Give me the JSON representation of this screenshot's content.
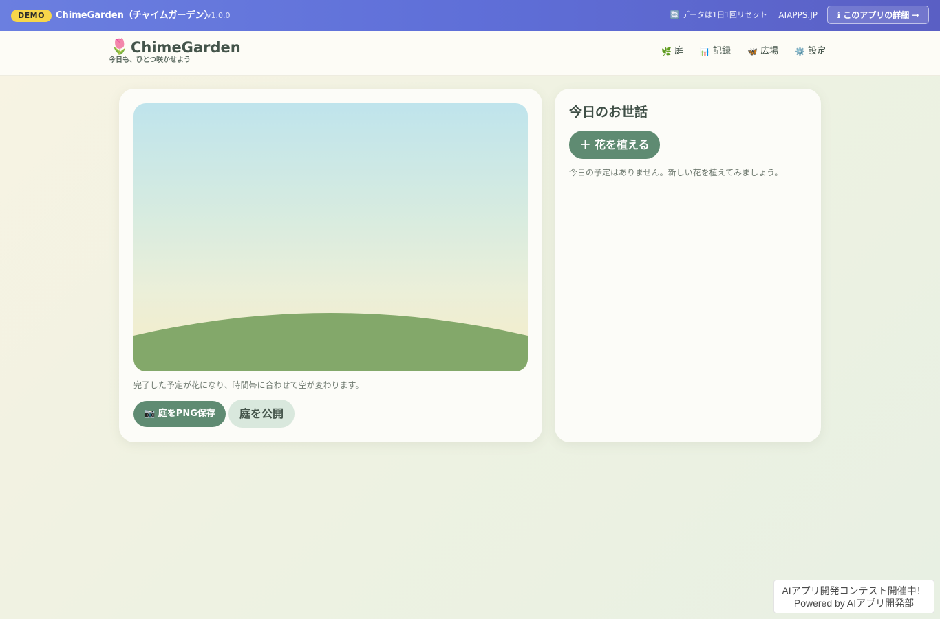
{
  "demo_bar": {
    "badge": "DEMO",
    "title": "ChimeGarden（チャイムガーデン）",
    "version": "v1.0.0",
    "reset_notice": "🔄 データは1日1回リセット",
    "site": "AIAPPS.JP",
    "detail_button": "ℹ このアプリの詳細 →"
  },
  "header": {
    "logo_icon": "🌷",
    "logo_text": "ChimeGarden",
    "tagline": "今日も、ひとつ咲かせよう",
    "nav": [
      {
        "icon": "🌿",
        "label": "庭"
      },
      {
        "icon": "📊",
        "label": "記録"
      },
      {
        "icon": "🦋",
        "label": "広場"
      },
      {
        "icon": "⚙️",
        "label": "設定"
      }
    ]
  },
  "garden": {
    "caption": "完了した予定が花になり、時間帯に合わせて空が変わります。",
    "save_png_button": "📷 庭をPNG保存",
    "publish_button": "庭を公開",
    "colors": {
      "sky_top": "#bfe4ec",
      "sky_bottom": "#f6ecc6",
      "hill": "#83a86a"
    }
  },
  "care": {
    "title": "今日のお世話",
    "plant_button": "＋ 花を植える",
    "empty_message": "今日の予定はありません。新しい花を植えてみましょう。"
  },
  "contest": {
    "line1": "AIアプリ開発コンテスト開催中！",
    "line2": "Powered by AIアプリ開発部"
  }
}
